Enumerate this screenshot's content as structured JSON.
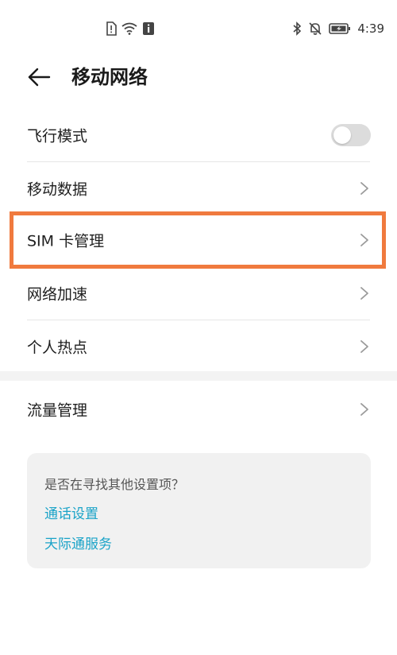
{
  "status_bar": {
    "time": "4:39"
  },
  "header": {
    "title": "移动网络"
  },
  "settings": {
    "airplane_mode": {
      "label": "飞行模式",
      "enabled": false
    },
    "mobile_data": {
      "label": "移动数据"
    },
    "sim_management": {
      "label": "SIM 卡管理"
    },
    "network_acceleration": {
      "label": "网络加速"
    },
    "personal_hotspot": {
      "label": "个人热点"
    },
    "data_usage": {
      "label": "流量管理"
    }
  },
  "suggestions": {
    "title": "是否在寻找其他设置项？",
    "links": [
      "通话设置",
      "天际通服务"
    ]
  },
  "colors": {
    "highlight": "#f07a3e",
    "link": "#1aa3c8"
  }
}
